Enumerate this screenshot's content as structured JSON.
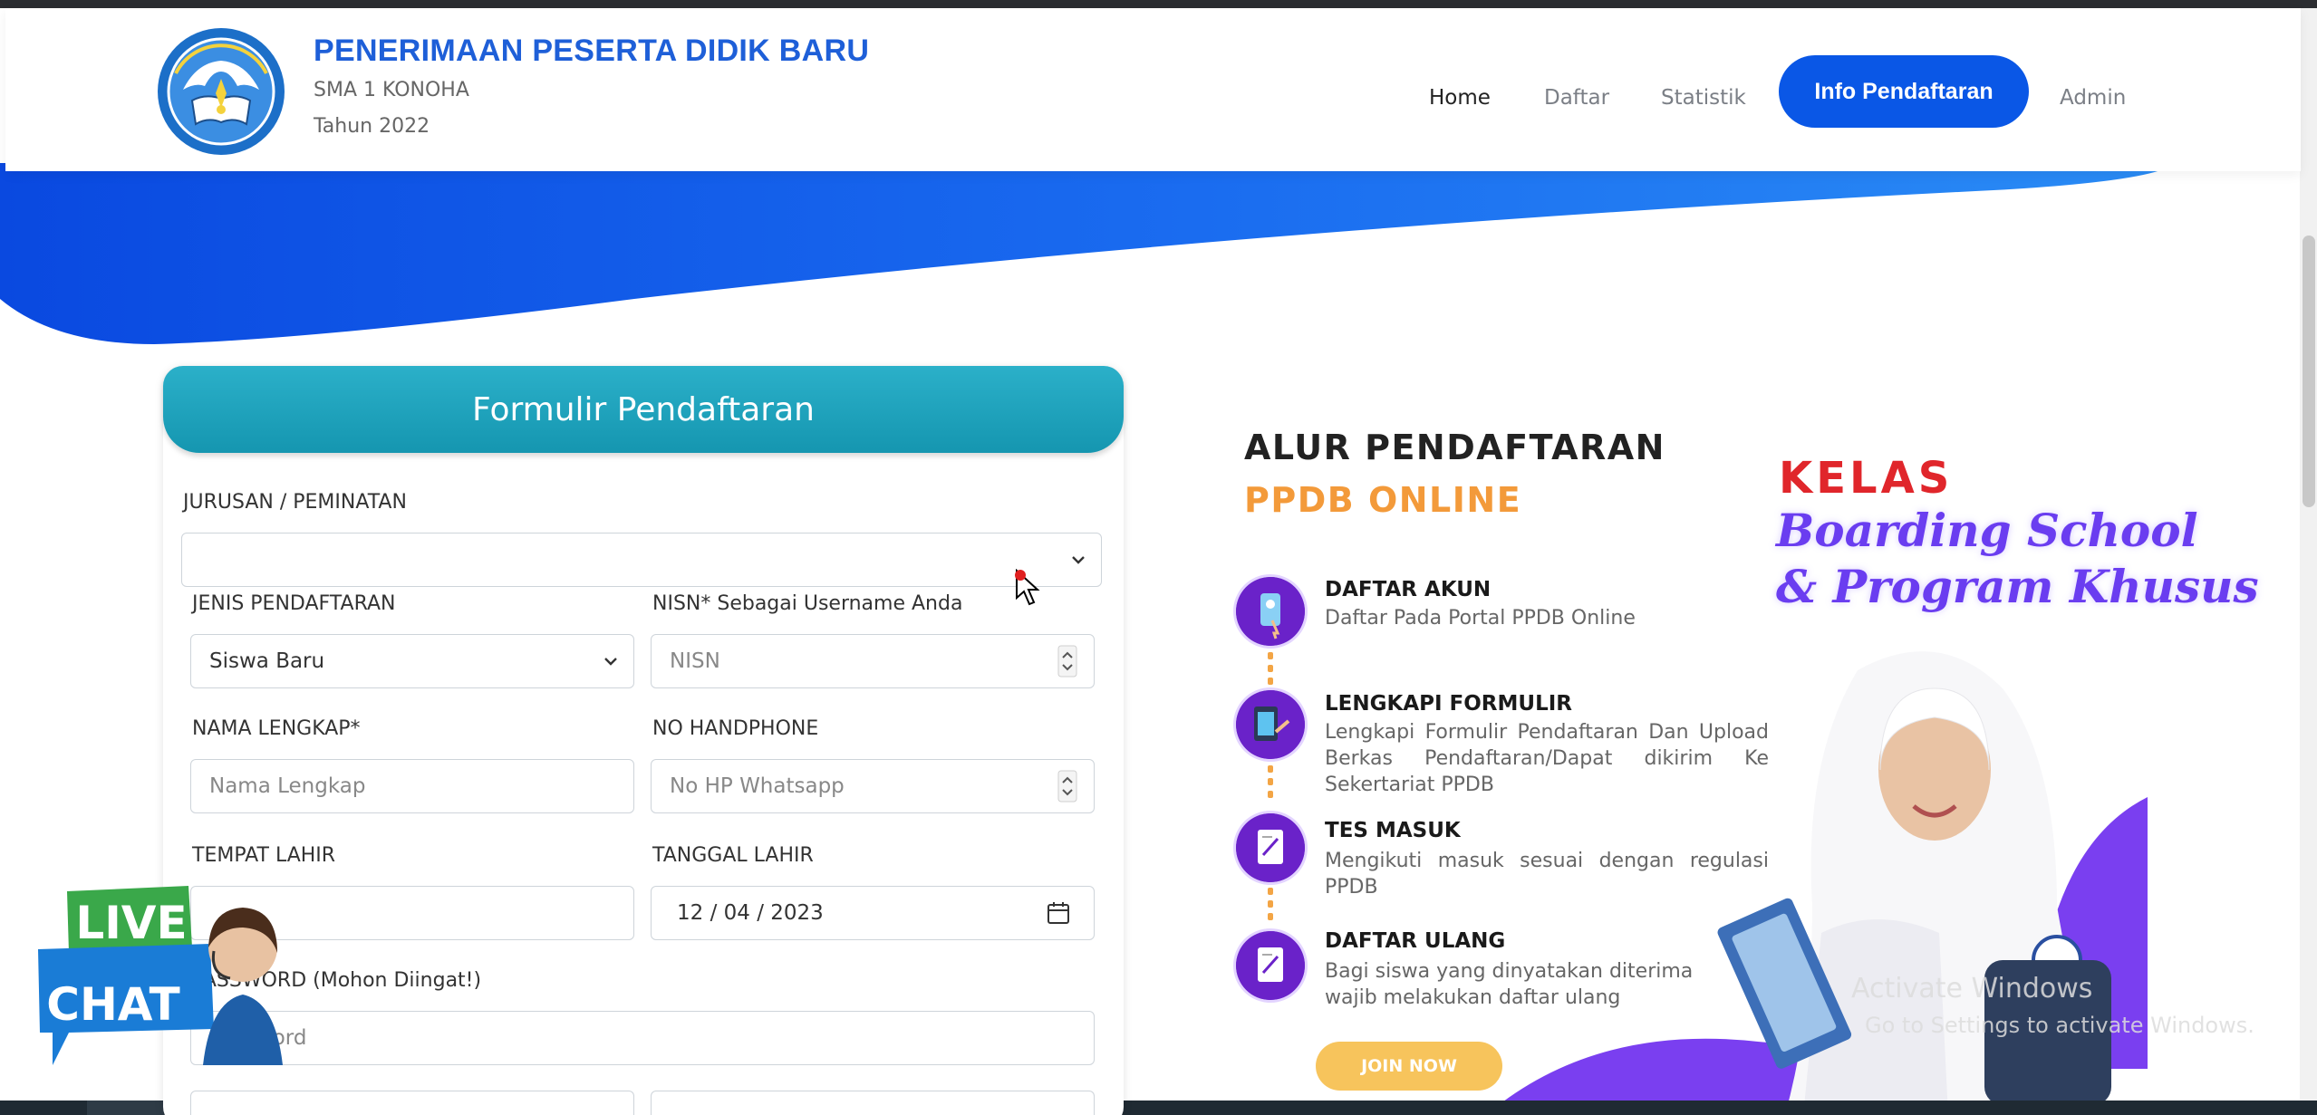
{
  "header": {
    "title": "PENERIMAAN PESERTA DIDIK BARU",
    "school": "SMA 1 KONOHA",
    "year": "Tahun 2022",
    "logo_icon": "tut-wuri-handayani-logo"
  },
  "nav": {
    "home": "Home",
    "daftar": "Daftar",
    "statistik": "Statistik",
    "info": "Info Pendaftaran",
    "admin": "Admin"
  },
  "form": {
    "title": "Formulir Pendaftaran",
    "jurusan_label": "JURUSAN / PEMINATAN",
    "jurusan_value": "",
    "jenis_label": "JENIS PENDAFTARAN",
    "jenis_value": "Siswa Baru",
    "nisn_label": "NISN* Sebagai Username Anda",
    "nisn_placeholder": "NISN",
    "nama_label": "NAMA LENGKAP*",
    "nama_placeholder": "Nama Lengkap",
    "hp_label": "NO HANDPHONE",
    "hp_placeholder": "No HP Whatsapp",
    "tempat_label": "TEMPAT LAHIR",
    "tempat_value": "",
    "tanggal_label": "TANGGAL LAHIR",
    "tanggal_value": "12 / 04 / 2023",
    "password_label": "PASSWORD (Mohon Diingat!)",
    "password_placeholder": "Password"
  },
  "promo": {
    "title1": "ALUR PENDAFTARAN",
    "title2": "PPDB ONLINE",
    "kelas": "KELAS",
    "boarding_line1": "Boarding School",
    "boarding_line2": "& Program Khusus",
    "steps": [
      {
        "title": "DAFTAR AKUN",
        "desc": "Daftar Pada Portal PPDB Online"
      },
      {
        "title": "LENGKAPI FORMULIR",
        "desc": "Lengkapi Formulir Pendaftaran Dan Upload Berkas Pendaftaran/Dapat dikirim Ke Sekertariat PPDB"
      },
      {
        "title": "TES MASUK",
        "desc": "Mengikuti masuk sesuai dengan regulasi PPDB"
      },
      {
        "title": "DAFTAR ULANG",
        "desc": "Bagi siswa yang dinyatakan diterima wajib melakukan daftar ulang"
      }
    ],
    "join": "JOIN NOW"
  },
  "livechat": {
    "line1": "LIVE",
    "line2": "CHAT"
  },
  "watermark": {
    "line1": "Activate Windows",
    "line2": "Go to Settings to activate Windows."
  },
  "colors": {
    "brand_blue": "#0a57e6",
    "form_header": "#1fa6bf",
    "step_purple": "#6a22c9",
    "accent_orange": "#f39a3a",
    "kelas_red": "#e0262b"
  }
}
